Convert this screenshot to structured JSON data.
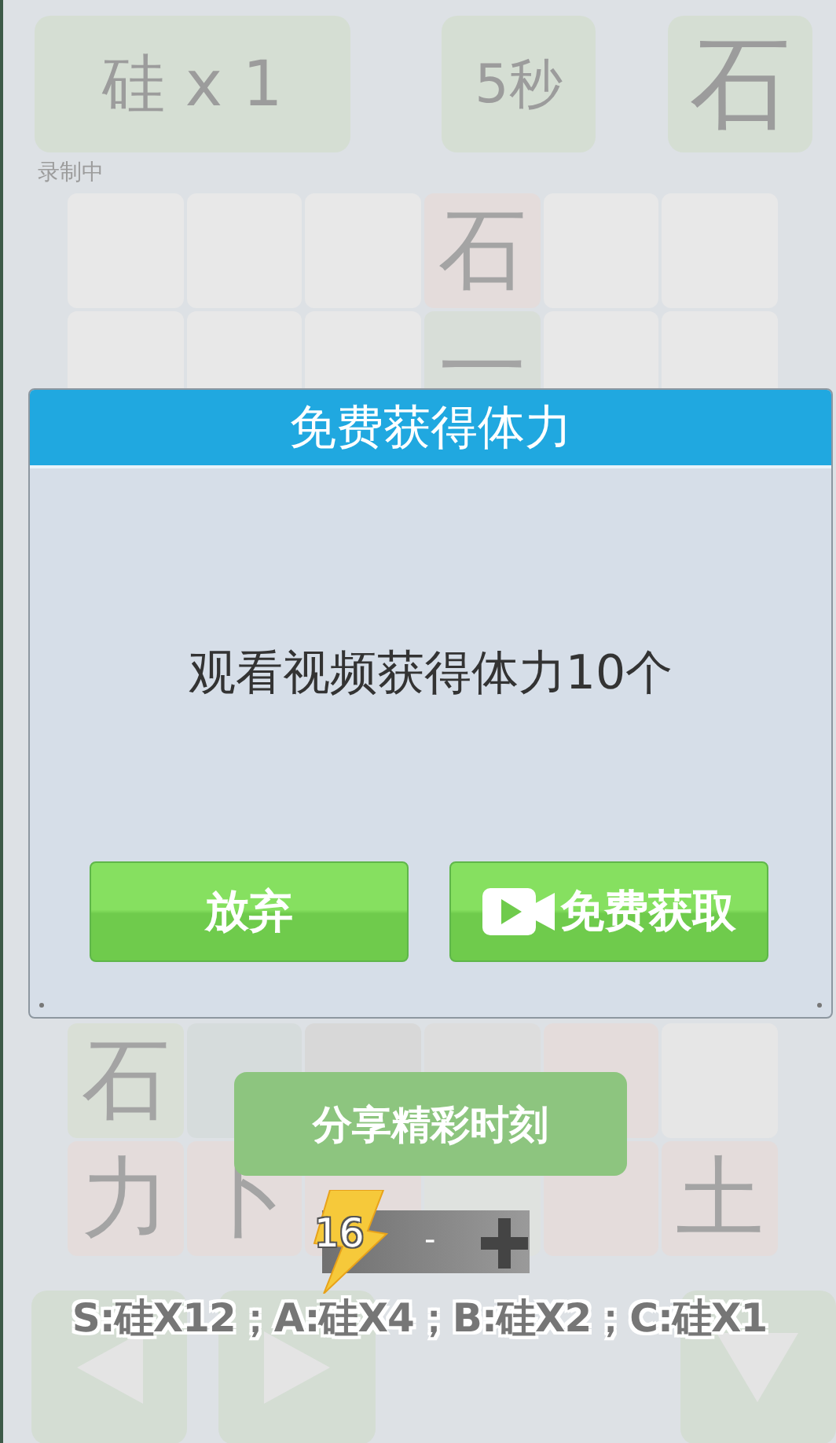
{
  "header": {
    "element": "硅 x 1",
    "timer": "5秒",
    "target": "石",
    "status": "录制中"
  },
  "grid_top": [
    [
      {
        "color": "#e8e8e8"
      },
      {
        "color": "#e8e8e8"
      },
      {
        "color": "#e8e8e8"
      },
      {
        "char": "石",
        "color": "#e4dcdb"
      },
      {
        "color": "#e8e8e8"
      },
      {
        "color": "#e8e8e8"
      }
    ],
    [
      {
        "color": "#e8e8e8"
      },
      {
        "color": "#e8e8e8"
      },
      {
        "color": "#e8e8e8"
      },
      {
        "char": "一",
        "color": "#d8ded8"
      },
      {
        "color": "#e8e8e8"
      },
      {
        "color": "#e8e8e8"
      }
    ]
  ],
  "grid_bottom": [
    [
      {
        "char": "石",
        "color": "#d9dfd6"
      },
      {
        "color": "#d6dcdc"
      },
      {
        "color": "#d8d8d8"
      },
      {
        "color": "#dddddd"
      },
      {
        "color": "#e4dcdb"
      },
      {
        "color": "#e6e6e6"
      }
    ],
    [
      {
        "char": "力",
        "color": "#e4dcdb"
      },
      {
        "char": "卜",
        "color": "#e4dcdb"
      },
      {
        "color": "#e4dcdb"
      },
      {
        "color": "#dfe2df"
      },
      {
        "color": "#e4dcdb"
      },
      {
        "char": "土",
        "color": "#e4dcdb"
      }
    ]
  ],
  "dialog": {
    "title": "免费获得体力",
    "message": "观看视频获得体力10个",
    "buttons": [
      {
        "label": "放弃",
        "kind": "plain"
      },
      {
        "label": "免费获取",
        "kind": "video"
      }
    ]
  },
  "share_button": "分享精彩时刻",
  "energy": {
    "count": "16",
    "minus": "-"
  },
  "rules": "S:硅X12；A:硅X4；B:硅X2；C:硅X1",
  "controls": [
    {
      "kind": "left"
    },
    {
      "kind": "right"
    },
    {
      "kind": "spacer"
    },
    {
      "kind": "down"
    }
  ]
}
